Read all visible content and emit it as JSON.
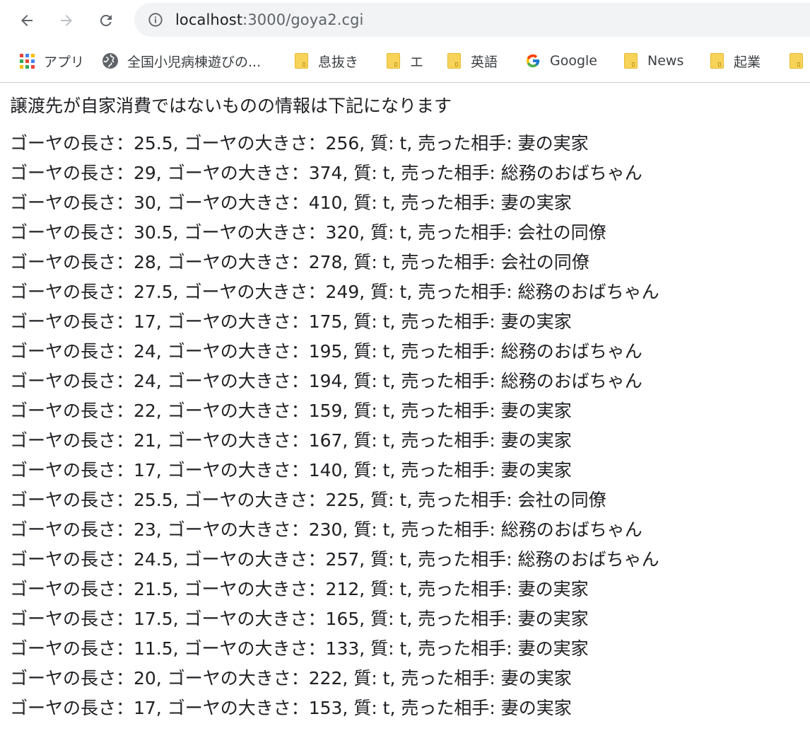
{
  "browser": {
    "url_host": "localhost",
    "url_path": ":3000/goya2.cgi",
    "bookmarks": [
      {
        "label": "アプリ",
        "icon": "apps-grid-icon"
      },
      {
        "label": "全国小児病棟遊びの...",
        "icon": "globe-icon"
      },
      {
        "label": "息抜き",
        "icon": "folder-icon"
      },
      {
        "label": "エ",
        "icon": "folder-icon"
      },
      {
        "label": "英語",
        "icon": "folder-icon"
      },
      {
        "label": "Google",
        "icon": "google-g-icon"
      },
      {
        "label": "News",
        "icon": "folder-icon"
      },
      {
        "label": "起業",
        "icon": "folder-icon"
      },
      {
        "label": "",
        "icon": "folder-icon"
      }
    ]
  },
  "page": {
    "heading": "譲渡先が自家消費ではないものの情報は下記になります",
    "rows": [
      "ゴーヤの長さ：25.5, ゴーヤの大きさ：256, 質: t, 売った相手: 妻の実家",
      "ゴーヤの長さ：29, ゴーヤの大きさ：374, 質: t, 売った相手: 総務のおばちゃん",
      "ゴーヤの長さ：30, ゴーヤの大きさ：410, 質: t, 売った相手: 妻の実家",
      "ゴーヤの長さ：30.5, ゴーヤの大きさ：320, 質: t, 売った相手: 会社の同僚",
      "ゴーヤの長さ：28, ゴーヤの大きさ：278, 質: t, 売った相手: 会社の同僚",
      "ゴーヤの長さ：27.5, ゴーヤの大きさ：249, 質: t, 売った相手: 総務のおばちゃん",
      "ゴーヤの長さ：17, ゴーヤの大きさ：175, 質: t, 売った相手: 妻の実家",
      "ゴーヤの長さ：24, ゴーヤの大きさ：195, 質: t, 売った相手: 総務のおばちゃん",
      "ゴーヤの長さ：24, ゴーヤの大きさ：194, 質: t, 売った相手: 総務のおばちゃん",
      "ゴーヤの長さ：22, ゴーヤの大きさ：159, 質: t, 売った相手: 妻の実家",
      "ゴーヤの長さ：21, ゴーヤの大きさ：167, 質: t, 売った相手: 妻の実家",
      "ゴーヤの長さ：17, ゴーヤの大きさ：140, 質: t, 売った相手: 妻の実家",
      "ゴーヤの長さ：25.5, ゴーヤの大きさ：225, 質: t, 売った相手: 会社の同僚",
      "ゴーヤの長さ：23, ゴーヤの大きさ：230, 質: t, 売った相手: 総務のおばちゃん",
      "ゴーヤの長さ：24.5, ゴーヤの大きさ：257, 質: t, 売った相手: 総務のおばちゃん",
      "ゴーヤの長さ：21.5, ゴーヤの大きさ：212, 質: t, 売った相手: 妻の実家",
      "ゴーヤの長さ：17.5, ゴーヤの大きさ：165, 質: t, 売った相手: 妻の実家",
      "ゴーヤの長さ：11.5, ゴーヤの大きさ：133, 質: t, 売った相手: 妻の実家",
      "ゴーヤの長さ：20, ゴーヤの大きさ：222, 質: t, 売った相手: 妻の実家",
      "ゴーヤの長さ：17, ゴーヤの大きさ：153, 質: t, 売った相手: 妻の実家"
    ]
  },
  "colors": {
    "omnibox_bg": "#f1f3f4",
    "folder": "#f7d35a",
    "text": "#202124"
  }
}
